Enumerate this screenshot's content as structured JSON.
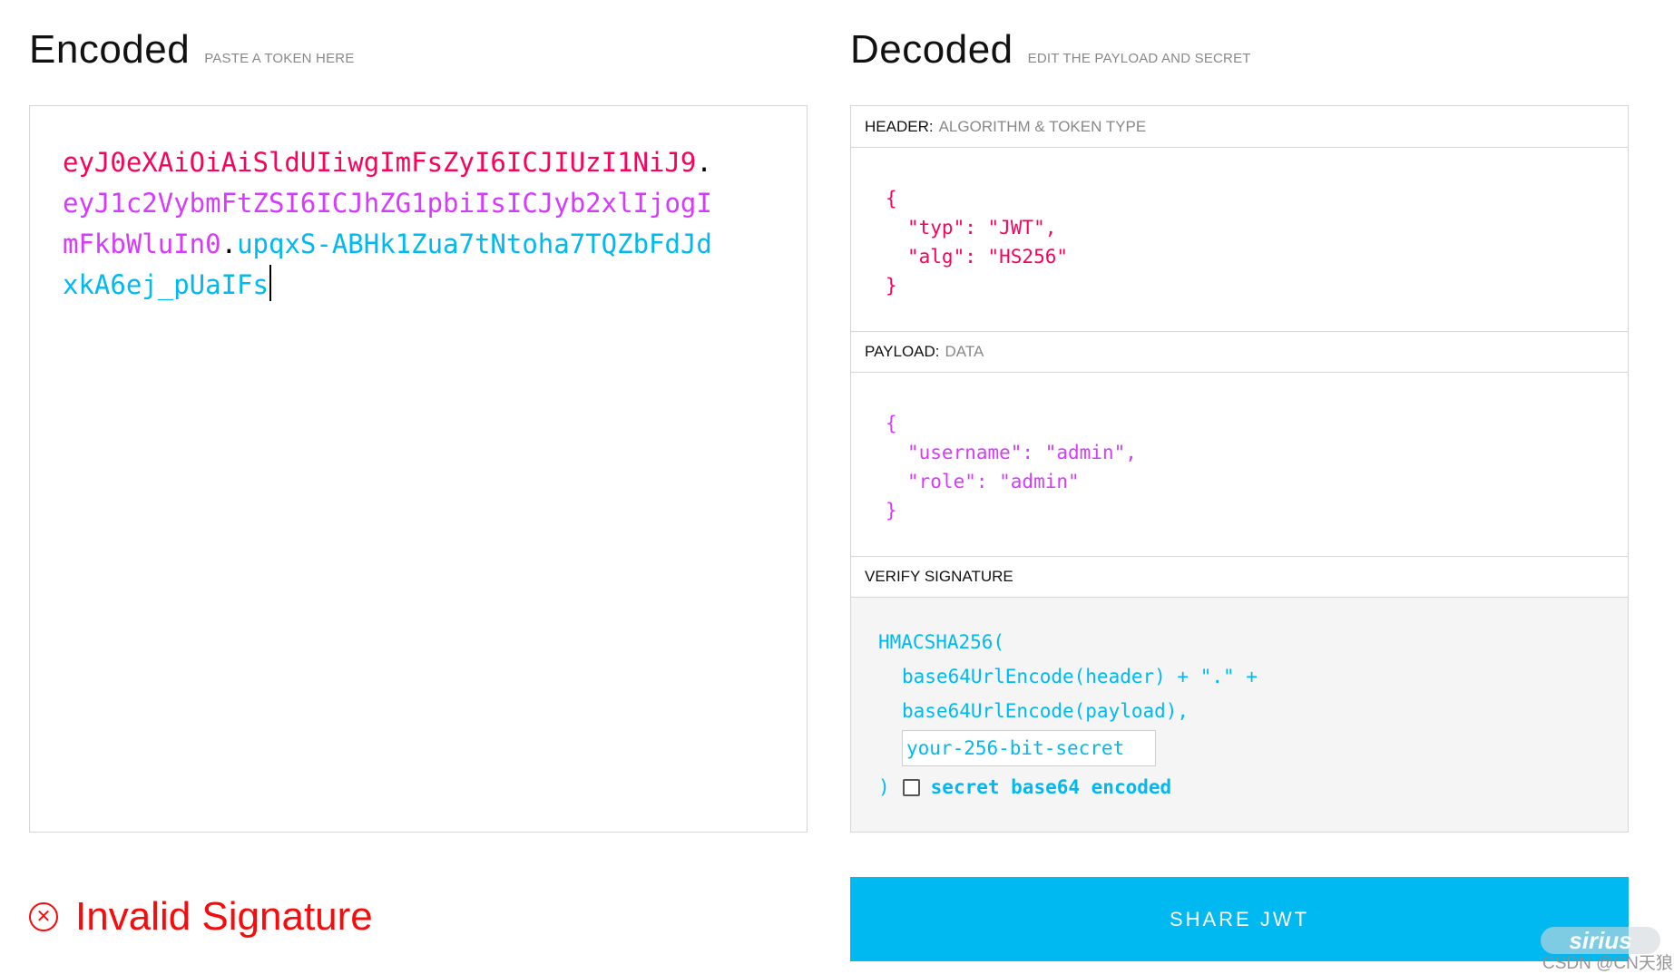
{
  "encoded": {
    "title": "Encoded",
    "subtitle": "PASTE A TOKEN HERE",
    "token": {
      "header": "eyJ0eXAiOiAiSldUIiwgImFsZyI6ICJIUzI1NiJ9",
      "payload": "eyJ1c2VybmFtZSI6ICJhZG1pbiIsICJyb2xlIjogImFkbWluIn0",
      "signature": "upqxS-ABHk1Zua7tNtoha7TQZbFdJdxkA6ej_pUaIFs",
      "dot": "."
    }
  },
  "decoded": {
    "title": "Decoded",
    "subtitle": "EDIT THE PAYLOAD AND SECRET",
    "header_section": {
      "label": "HEADER:",
      "sublabel": "ALGORITHM & TOKEN TYPE",
      "lines": [
        "{",
        "\"typ\": \"JWT\",",
        "\"alg\": \"HS256\"",
        "}"
      ]
    },
    "payload_section": {
      "label": "PAYLOAD:",
      "sublabel": "DATA",
      "lines": [
        "{",
        "\"username\": \"admin\",",
        "\"role\": \"admin\"",
        "}"
      ]
    },
    "signature_section": {
      "label": "VERIFY SIGNATURE",
      "line1": "HMACSHA256(",
      "line2": "base64UrlEncode(header) + \".\" +",
      "line3": "base64UrlEncode(payload),",
      "secret_placeholder": "your-256-bit-secret",
      "close_paren": ")",
      "checkbox_label": "secret base64 encoded",
      "checkbox_checked": false
    }
  },
  "status": {
    "icon": "close-circle-icon",
    "text": "Invalid Signature",
    "color": "#f50c0c"
  },
  "share_button": {
    "label": "SHARE JWT"
  },
  "watermark": {
    "logo_text": "sirius",
    "text": "CSDN @CN天狼"
  },
  "colors": {
    "header": "#fb015b",
    "payload": "#d63aff",
    "signature": "#00b9f1",
    "button": "#00b9f1"
  }
}
